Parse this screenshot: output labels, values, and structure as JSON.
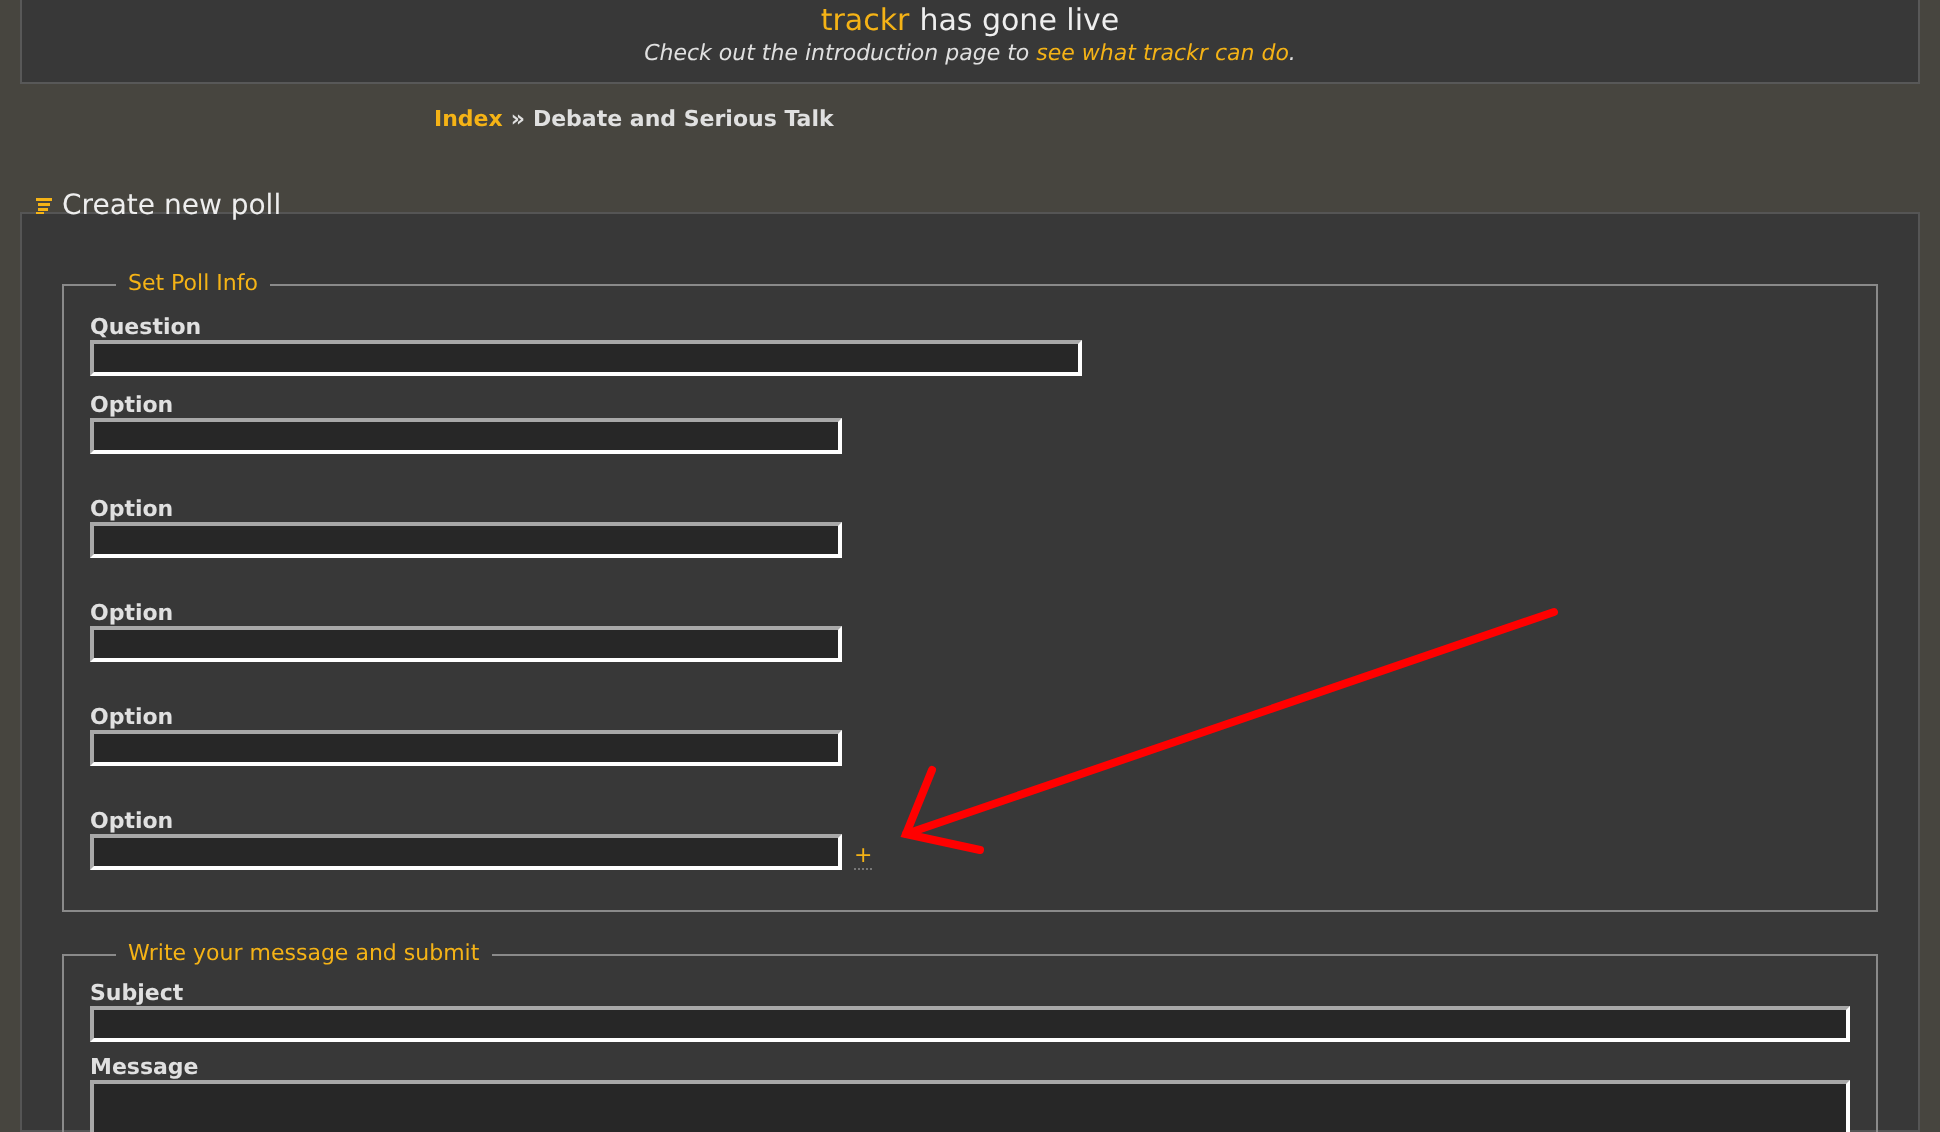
{
  "banner": {
    "brand": "trackr",
    "title": "has gone live",
    "text": "Check out the introduction page to",
    "link": "see what trackr can do",
    "after_link": "."
  },
  "breadcrumb": {
    "home": "Index",
    "separator": "»",
    "current": "Debate and Serious Talk"
  },
  "heading": "Create new poll",
  "poll": {
    "legend": "Set Poll Info",
    "question_label": "Question",
    "options": [
      {
        "label": "Option"
      },
      {
        "label": "Option"
      },
      {
        "label": "Option"
      },
      {
        "label": "Option"
      },
      {
        "label": "Option"
      }
    ],
    "add_option": "+"
  },
  "message": {
    "legend": "Write your message and submit",
    "subject_label": "Subject",
    "message_label": "Message"
  }
}
